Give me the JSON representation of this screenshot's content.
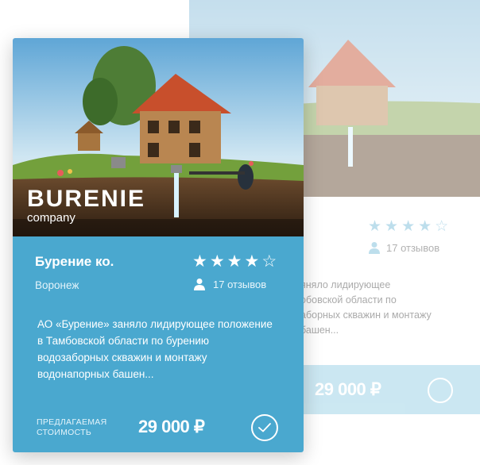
{
  "colors": {
    "card_accent": "#4aa8cf",
    "faded_accent": "#8ecbe3",
    "text_on_accent": "#ffffff"
  },
  "back_card": {
    "rating": 4.5,
    "stars_text": "★★★★☆",
    "reviews": "17 отзывов",
    "description": "яняло лидирующее\nобовской области по\nаборных скважин и монтажу\nбашен...",
    "price": "29 000 ₽"
  },
  "front_card": {
    "logo_main": "BURENIE",
    "logo_sub": "company",
    "title": "Бурение ко.",
    "city": "Воронеж",
    "rating": 4.5,
    "reviews": "17 отзывов",
    "description": "АО «Бурение» заняло лидирующее положение в Тамбовской области по бурению водозаборных скважин и монтажу водонапорных башен...",
    "price_label": "ПРЕДЛАГАЕМАЯ СТОИМОСТЬ",
    "price": "29 000 ₽",
    "icons": {
      "star": "star-icon",
      "user": "user-icon",
      "check": "check-icon"
    }
  }
}
